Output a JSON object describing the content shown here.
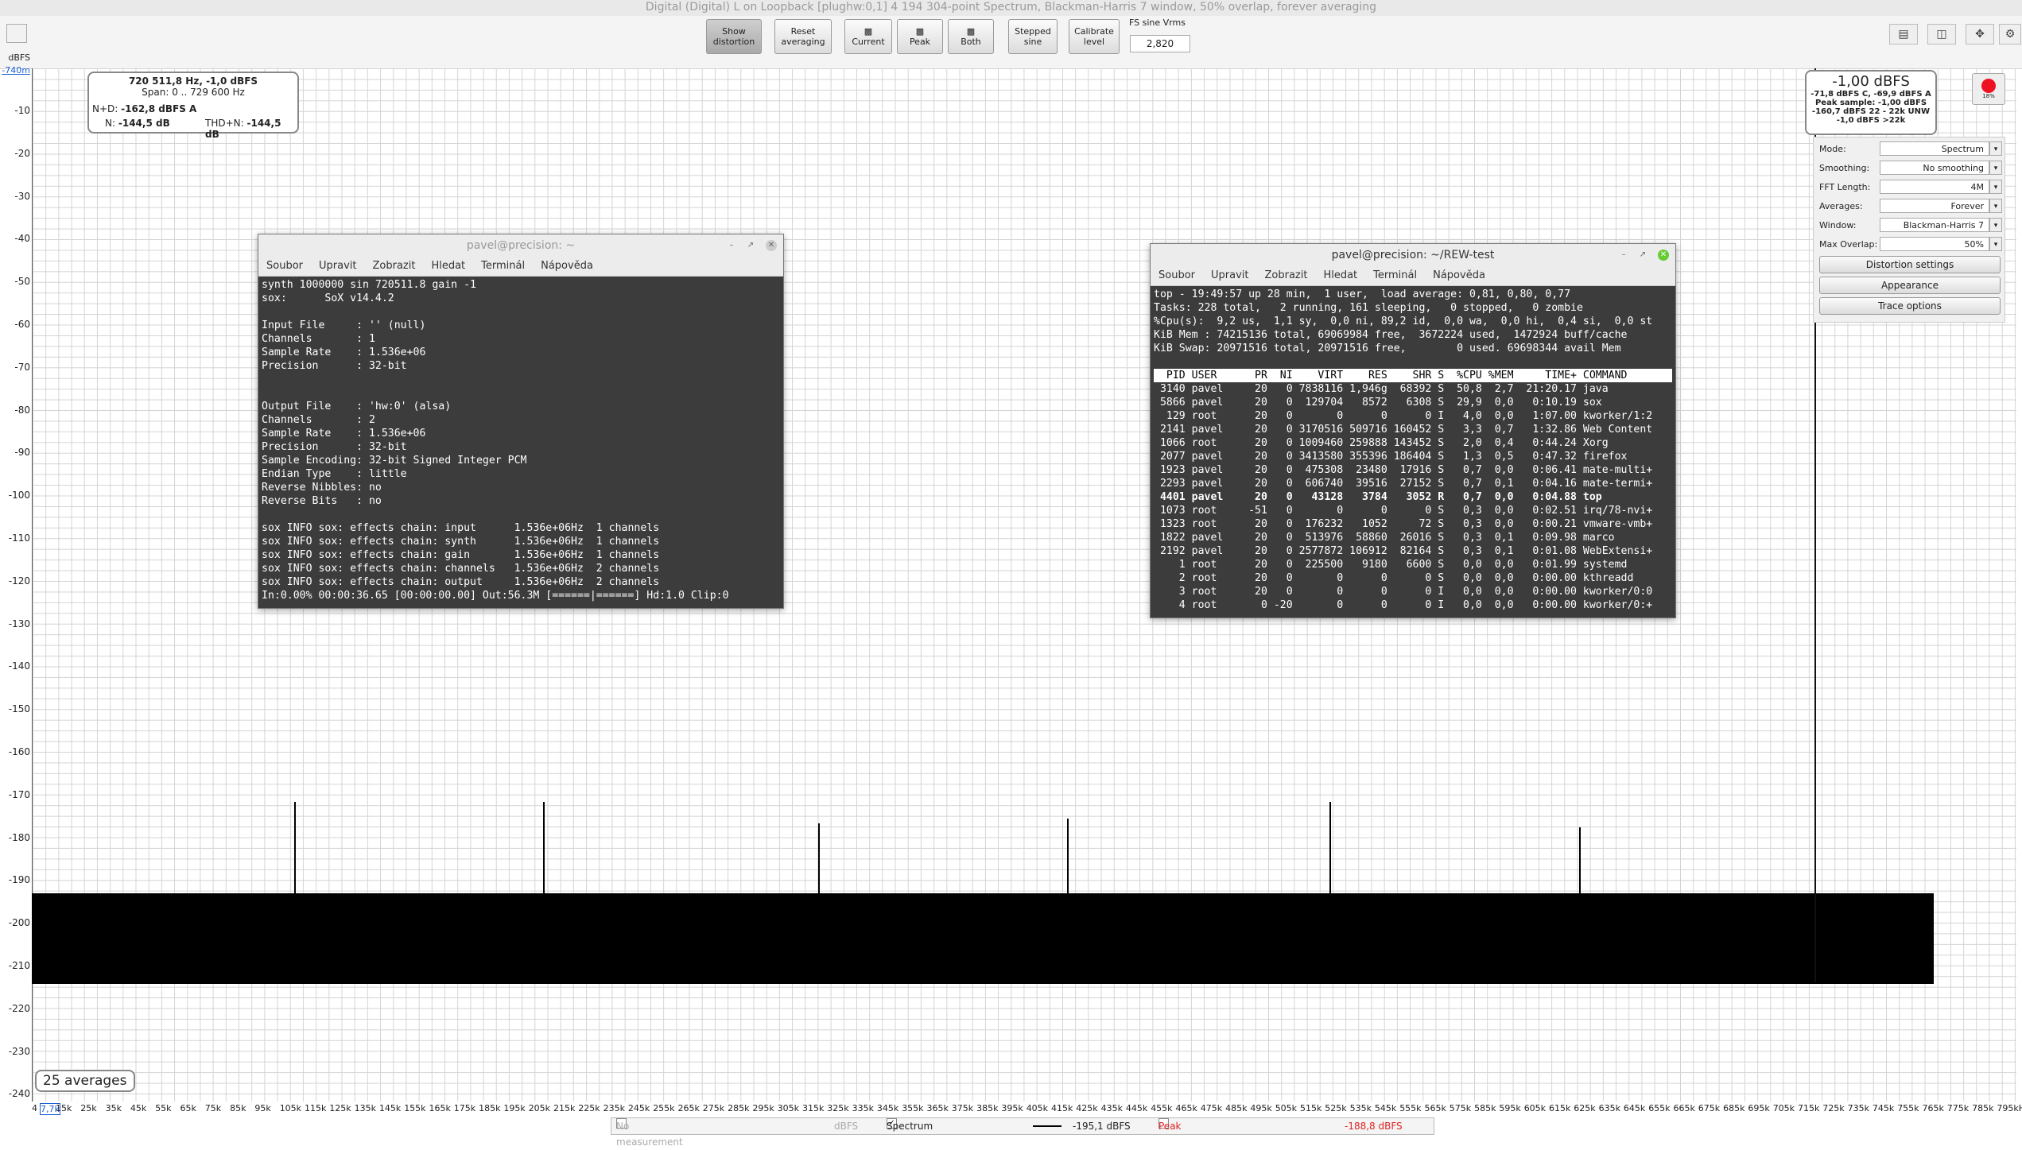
{
  "window": {
    "title": "Digital (Digital) L on Loopback [plughw:0,1] 4 194 304-point Spectrum, Blackman-Harris 7 window, 50% overlap, forever averaging"
  },
  "toolbar": {
    "show_distortion": "Show distortion",
    "reset_averaging": "Reset averaging",
    "current": "Current",
    "peak": "Peak",
    "both": "Both",
    "stepped_sine": "Stepped sine",
    "calibrate_level": "Calibrate level",
    "fs_label": "FS sine Vrms",
    "fs_value": "2,820"
  },
  "yaxis": {
    "unit": "dBFS",
    "top_value": "-740m",
    "ticks": [
      "-10",
      "-20",
      "-30",
      "-40",
      "-50",
      "-60",
      "-70",
      "-80",
      "-90",
      "-100",
      "-110",
      "-120",
      "-130",
      "-140",
      "-150",
      "-160",
      "-170",
      "-180",
      "-190",
      "-200",
      "-210",
      "-220",
      "-230",
      "-240"
    ]
  },
  "xaxis": {
    "first": "4",
    "cursor": "7,7k",
    "ticks": [
      "15k",
      "25k",
      "35k",
      "45k",
      "55k",
      "65k",
      "75k",
      "85k",
      "95k",
      "105k",
      "115k",
      "125k",
      "135k",
      "145k",
      "155k",
      "165k",
      "175k",
      "185k",
      "195k",
      "205k",
      "215k",
      "225k",
      "235k",
      "245k",
      "255k",
      "265k",
      "275k",
      "285k",
      "295k",
      "305k",
      "315k",
      "325k",
      "335k",
      "345k",
      "355k",
      "365k",
      "375k",
      "385k",
      "395k",
      "405k",
      "415k",
      "425k",
      "435k",
      "445k",
      "455k",
      "465k",
      "475k",
      "485k",
      "495k",
      "505k",
      "515k",
      "525k",
      "535k",
      "545k",
      "555k",
      "565k",
      "575k",
      "585k",
      "595k",
      "605k",
      "615k",
      "625k",
      "635k",
      "645k",
      "655k",
      "665k",
      "675k",
      "685k",
      "695k",
      "705k",
      "715k",
      "725k",
      "735k",
      "745k",
      "755k",
      "765k",
      "775k",
      "785k",
      "795kHz"
    ]
  },
  "info_box": {
    "line1": "720 511,8 Hz, -1,0 dBFS",
    "line2": "Span: 0 .. 729 600 Hz",
    "nd_label": "N+D:",
    "nd_value": "-162,8 dBFS A",
    "n_label": "N:",
    "n_value": "-144,5 dB",
    "thdn_label": "THD+N:",
    "thdn_value": "-144,5 dB"
  },
  "level_box": {
    "main": "-1,00 dBFS",
    "l1": "-71,8 dBFS C, -69,9 dBFS A",
    "l2": "Peak sample: -1,00 dBFS",
    "l3": "-160,7 dBFS 22 - 22k UNW",
    "l4": "-1,0 dBFS >22k"
  },
  "rec_label": "18%",
  "averages": "25 averages",
  "panel": {
    "rows": [
      {
        "label": "Mode:",
        "value": "Spectrum"
      },
      {
        "label": "Smoothing:",
        "value": "No  smoothing"
      },
      {
        "label": "FFT Length:",
        "value": "4M"
      },
      {
        "label": "Averages:",
        "value": "Forever"
      },
      {
        "label": "Window:",
        "value": "Blackman-Harris 7"
      },
      {
        "label": "Max Overlap:",
        "value": "50%"
      }
    ],
    "distortion_settings": "Distortion settings",
    "appearance": "Appearance",
    "trace_options": "Trace options"
  },
  "term1": {
    "title": "pavel@precision: ~",
    "menu": [
      "Soubor",
      "Upravit",
      "Zobrazit",
      "Hledat",
      "Terminál",
      "Nápověda"
    ],
    "lines": [
      "synth 1000000 sin 720511.8 gain -1",
      "sox:      SoX v14.4.2",
      "",
      "Input File     : '' (null)",
      "Channels       : 1",
      "Sample Rate    : 1.536e+06",
      "Precision      : 32-bit",
      "",
      "",
      "Output File    : 'hw:0' (alsa)",
      "Channels       : 2",
      "Sample Rate    : 1.536e+06",
      "Precision      : 32-bit",
      "Sample Encoding: 32-bit Signed Integer PCM",
      "Endian Type    : little",
      "Reverse Nibbles: no",
      "Reverse Bits   : no",
      "",
      "sox INFO sox: effects chain: input      1.536e+06Hz  1 channels",
      "sox INFO sox: effects chain: synth      1.536e+06Hz  1 channels",
      "sox INFO sox: effects chain: gain       1.536e+06Hz  1 channels",
      "sox INFO sox: effects chain: channels   1.536e+06Hz  2 channels",
      "sox INFO sox: effects chain: output     1.536e+06Hz  2 channels",
      "In:0.00% 00:00:36.65 [00:00:00.00] Out:56.3M [======|======] Hd:1.0 Clip:0"
    ]
  },
  "term2": {
    "title": "pavel@precision: ~/REW-test",
    "menu": [
      "Soubor",
      "Upravit",
      "Zobrazit",
      "Hledat",
      "Terminál",
      "Nápověda"
    ],
    "header_lines": [
      "top - 19:49:57 up 28 min,  1 user,  load average: 0,81, 0,80, 0,77",
      "Tasks: 228 total,   2 running, 161 sleeping,   0 stopped,   0 zombie",
      "%Cpu(s):  9,2 us,  1,1 sy,  0,0 ni, 89,2 id,  0,0 wa,  0,0 hi,  0,4 si,  0,0 st",
      "KiB Mem : 74215136 total, 69069984 free,  3672224 used,  1472924 buff/cache",
      "KiB Swap: 20971516 total, 20971516 free,        0 used. 69698344 avail Mem"
    ],
    "table_header": "  PID USER      PR  NI    VIRT    RES    SHR S  %CPU %MEM     TIME+ COMMAND",
    "rows": [
      " 3140 pavel     20   0 7838116 1,946g  68392 S  50,8  2,7  21:20.17 java",
      " 5866 pavel     20   0  129704   8572   6308 S  29,9  0,0   0:10.19 sox",
      "  129 root      20   0       0      0      0 I   4,0  0,0   1:07.00 kworker/1:2",
      " 2141 pavel     20   0 3170516 509716 160452 S   3,3  0,7   1:32.86 Web Content",
      " 1066 root      20   0 1009460 259888 143452 S   2,0  0,4   0:44.24 Xorg",
      " 2077 pavel     20   0 3413580 355396 186404 S   1,3  0,5   0:47.32 firefox",
      " 1923 pavel     20   0  475308  23480  17916 S   0,7  0,0   0:06.41 mate-multi+",
      " 2293 pavel     20   0  606740  39516  27152 S   0,7  0,1   0:04.16 mate-termi+",
      " 4401 pavel     20   0   43128   3784   3052 R   0,7  0,0   0:04.88 top",
      " 1073 root     -51   0       0      0      0 S   0,3  0,0   0:02.51 irq/78-nvi+",
      " 1323 root      20   0  176232   1052     72 S   0,3  0,0   0:00.21 vmware-vmb+",
      " 1822 pavel     20   0  513976  58860  26016 S   0,3  0,1   0:09.98 marco",
      " 2192 pavel     20   0 2577872 106912  82164 S   0,3  0,1   0:01.08 WebExtensi+",
      "    1 root      20   0  225500   9180   6600 S   0,0  0,0   0:01.99 systemd",
      "    2 root      20   0       0      0      0 S   0,0  0,0   0:00.00 kthreadd",
      "    3 root      20   0       0      0      0 I   0,0  0,0   0:00.00 kworker/0:0",
      "    4 root       0 -20       0      0      0 I   0,0  0,0   0:00.00 kworker/0:+"
    ]
  },
  "legend": {
    "no_measurement": "No measurement",
    "no_measurement_unit": "dBFS",
    "spectrum": "Spectrum",
    "spectrum_value": "-195,1 dBFS",
    "peak": "Peak",
    "peak_value": "-188,8 dBFS"
  },
  "chart_data": {
    "type": "line",
    "xlabel": "",
    "ylabel": "dBFS",
    "ylim": [
      -240,
      -740
    ],
    "xlim": [
      4,
      795000
    ],
    "series": [
      {
        "name": "Spectrum",
        "noise_floor_range": [
          -210,
          -198
        ],
        "spikes_x_hz": [
          105000,
          205000,
          315000,
          415000,
          520000,
          620000,
          720500
        ],
        "spikes_db": [
          -173,
          -173,
          -178,
          -177,
          -173,
          -179,
          -1
        ]
      }
    ]
  }
}
